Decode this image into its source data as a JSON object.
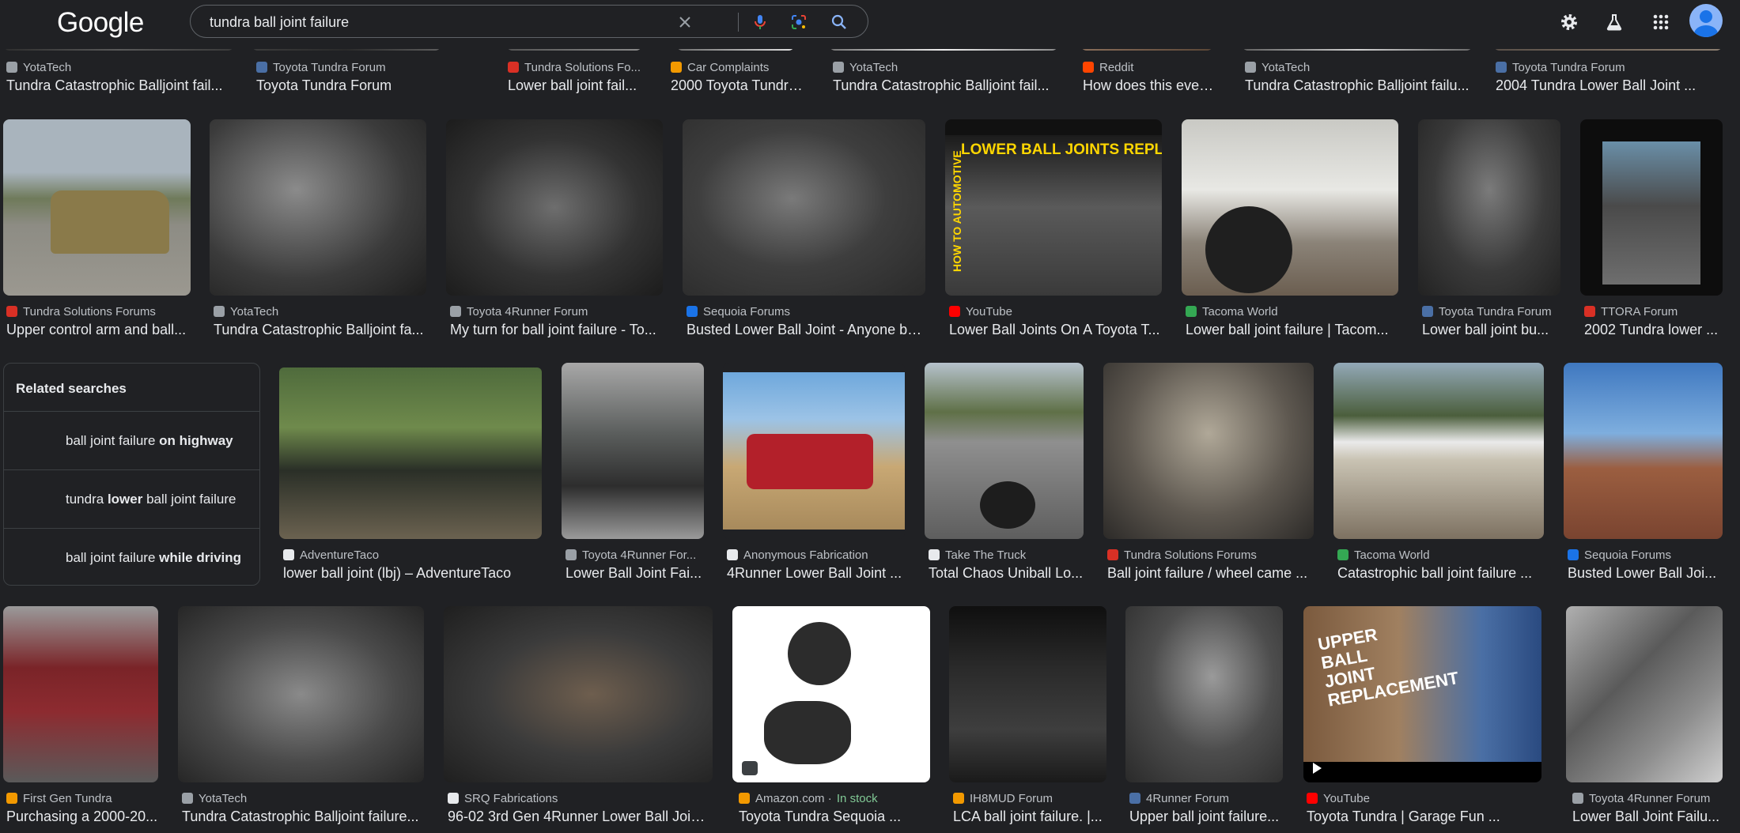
{
  "header": {
    "logo": "Google",
    "query": "tundra ball joint failure"
  },
  "icons": {
    "clear": "close-icon",
    "voice": "mic-icon",
    "lens": "lens-icon",
    "search": "search-icon",
    "settings": "gear-icon",
    "labs": "flask-icon",
    "apps": "apps-grid-icon",
    "account": "avatar"
  },
  "colors": {
    "background": "#202124",
    "text": "#e8eaed",
    "subtext": "#bdc1c6",
    "in_stock": "#81c995"
  },
  "rows": [
    {
      "tiles": [
        {
          "source": "YotaTech",
          "title": "Tundra Catastrophic Balljoint fail..."
        },
        {
          "source": "Toyota Tundra Forum",
          "title": "Toyota Tundra Forum"
        },
        {
          "source": "Tundra Solutions Fo...",
          "title": "Lower ball joint fail..."
        },
        {
          "source": "Car Complaints",
          "title": "2000 Toyota Tundra..."
        },
        {
          "source": "YotaTech",
          "title": "Tundra Catastrophic Balljoint fail..."
        },
        {
          "source": "Reddit",
          "title": "How does this even..."
        },
        {
          "source": "YotaTech",
          "title": "Tundra Catastrophic Balljoint failu..."
        },
        {
          "source": "Toyota Tundra Forum",
          "title": "2004 Tundra Lower Ball Joint ..."
        }
      ]
    },
    {
      "tiles": [
        {
          "source": "Tundra Solutions Forums",
          "title": "Upper control arm and ball..."
        },
        {
          "source": "YotaTech",
          "title": "Tundra Catastrophic Balljoint fa..."
        },
        {
          "source": "Toyota 4Runner Forum",
          "title": "My turn for ball joint failure - To..."
        },
        {
          "source": "Sequoia Forums",
          "title": "Busted Lower Ball Joint - Anyone be..."
        },
        {
          "source": "YouTube",
          "title": "Lower Ball Joints On A Toyota T...",
          "overlay": "LOWER BALL JOINTS REPLACEMEN",
          "side_text": "HOW TO AUTOMOTIVE"
        },
        {
          "source": "Tacoma World",
          "title": "Lower ball joint failure | Tacom..."
        },
        {
          "source": "Toyota Tundra Forum",
          "title": "Lower ball joint bu..."
        },
        {
          "source": "TTORA Forum",
          "title": "2002 Tundra lower ..."
        }
      ]
    },
    {
      "tiles": [
        {
          "source": "AdventureTaco",
          "title": "lower ball joint (lbj) – AdventureTaco"
        },
        {
          "source": "Toyota 4Runner For...",
          "title": "Lower Ball Joint Fai..."
        },
        {
          "source": "Anonymous Fabrication",
          "title": "4Runner Lower Ball Joint ..."
        },
        {
          "source": "Take The Truck",
          "title": "Total Chaos Uniball Lo..."
        },
        {
          "source": "Tundra Solutions Forums",
          "title": "Ball joint failure / wheel came ..."
        },
        {
          "source": "Tacoma World",
          "title": "Catastrophic ball joint failure ..."
        },
        {
          "source": "Sequoia Forums",
          "title": "Busted Lower Ball Joi..."
        }
      ]
    },
    {
      "tiles": [
        {
          "source": "First Gen Tundra",
          "title": "Purchasing a 2000-20..."
        },
        {
          "source": "YotaTech",
          "title": "Tundra Catastrophic Balljoint failure..."
        },
        {
          "source": "SRQ Fabrications",
          "title": "96-02 3rd Gen 4Runner Lower Ball Joint ..."
        },
        {
          "source": "Amazon.com",
          "source_extra": "In stock",
          "title": "Toyota Tundra Sequoia ..."
        },
        {
          "source": "IH8MUD Forum",
          "title": "LCA ball joint failure. |..."
        },
        {
          "source": "4Runner Forum",
          "title": "Upper ball joint failure..."
        },
        {
          "source": "YouTube",
          "title": "Toyota Tundra | Garage Fun ...",
          "overlay": "UPPER BALL JOINT REPLACEMENT"
        },
        {
          "source": "Toyota 4Runner Forum",
          "title": "Lower Ball Joint Failu..."
        }
      ]
    }
  ],
  "related": {
    "title": "Related searches",
    "items": [
      {
        "normal": "ball joint failure ",
        "bold": "on highway",
        "after": ""
      },
      {
        "normal": "tundra ",
        "bold": "lower",
        "after": " ball joint failure"
      },
      {
        "normal": "ball joint failure ",
        "bold": "while driving",
        "after": ""
      }
    ]
  }
}
